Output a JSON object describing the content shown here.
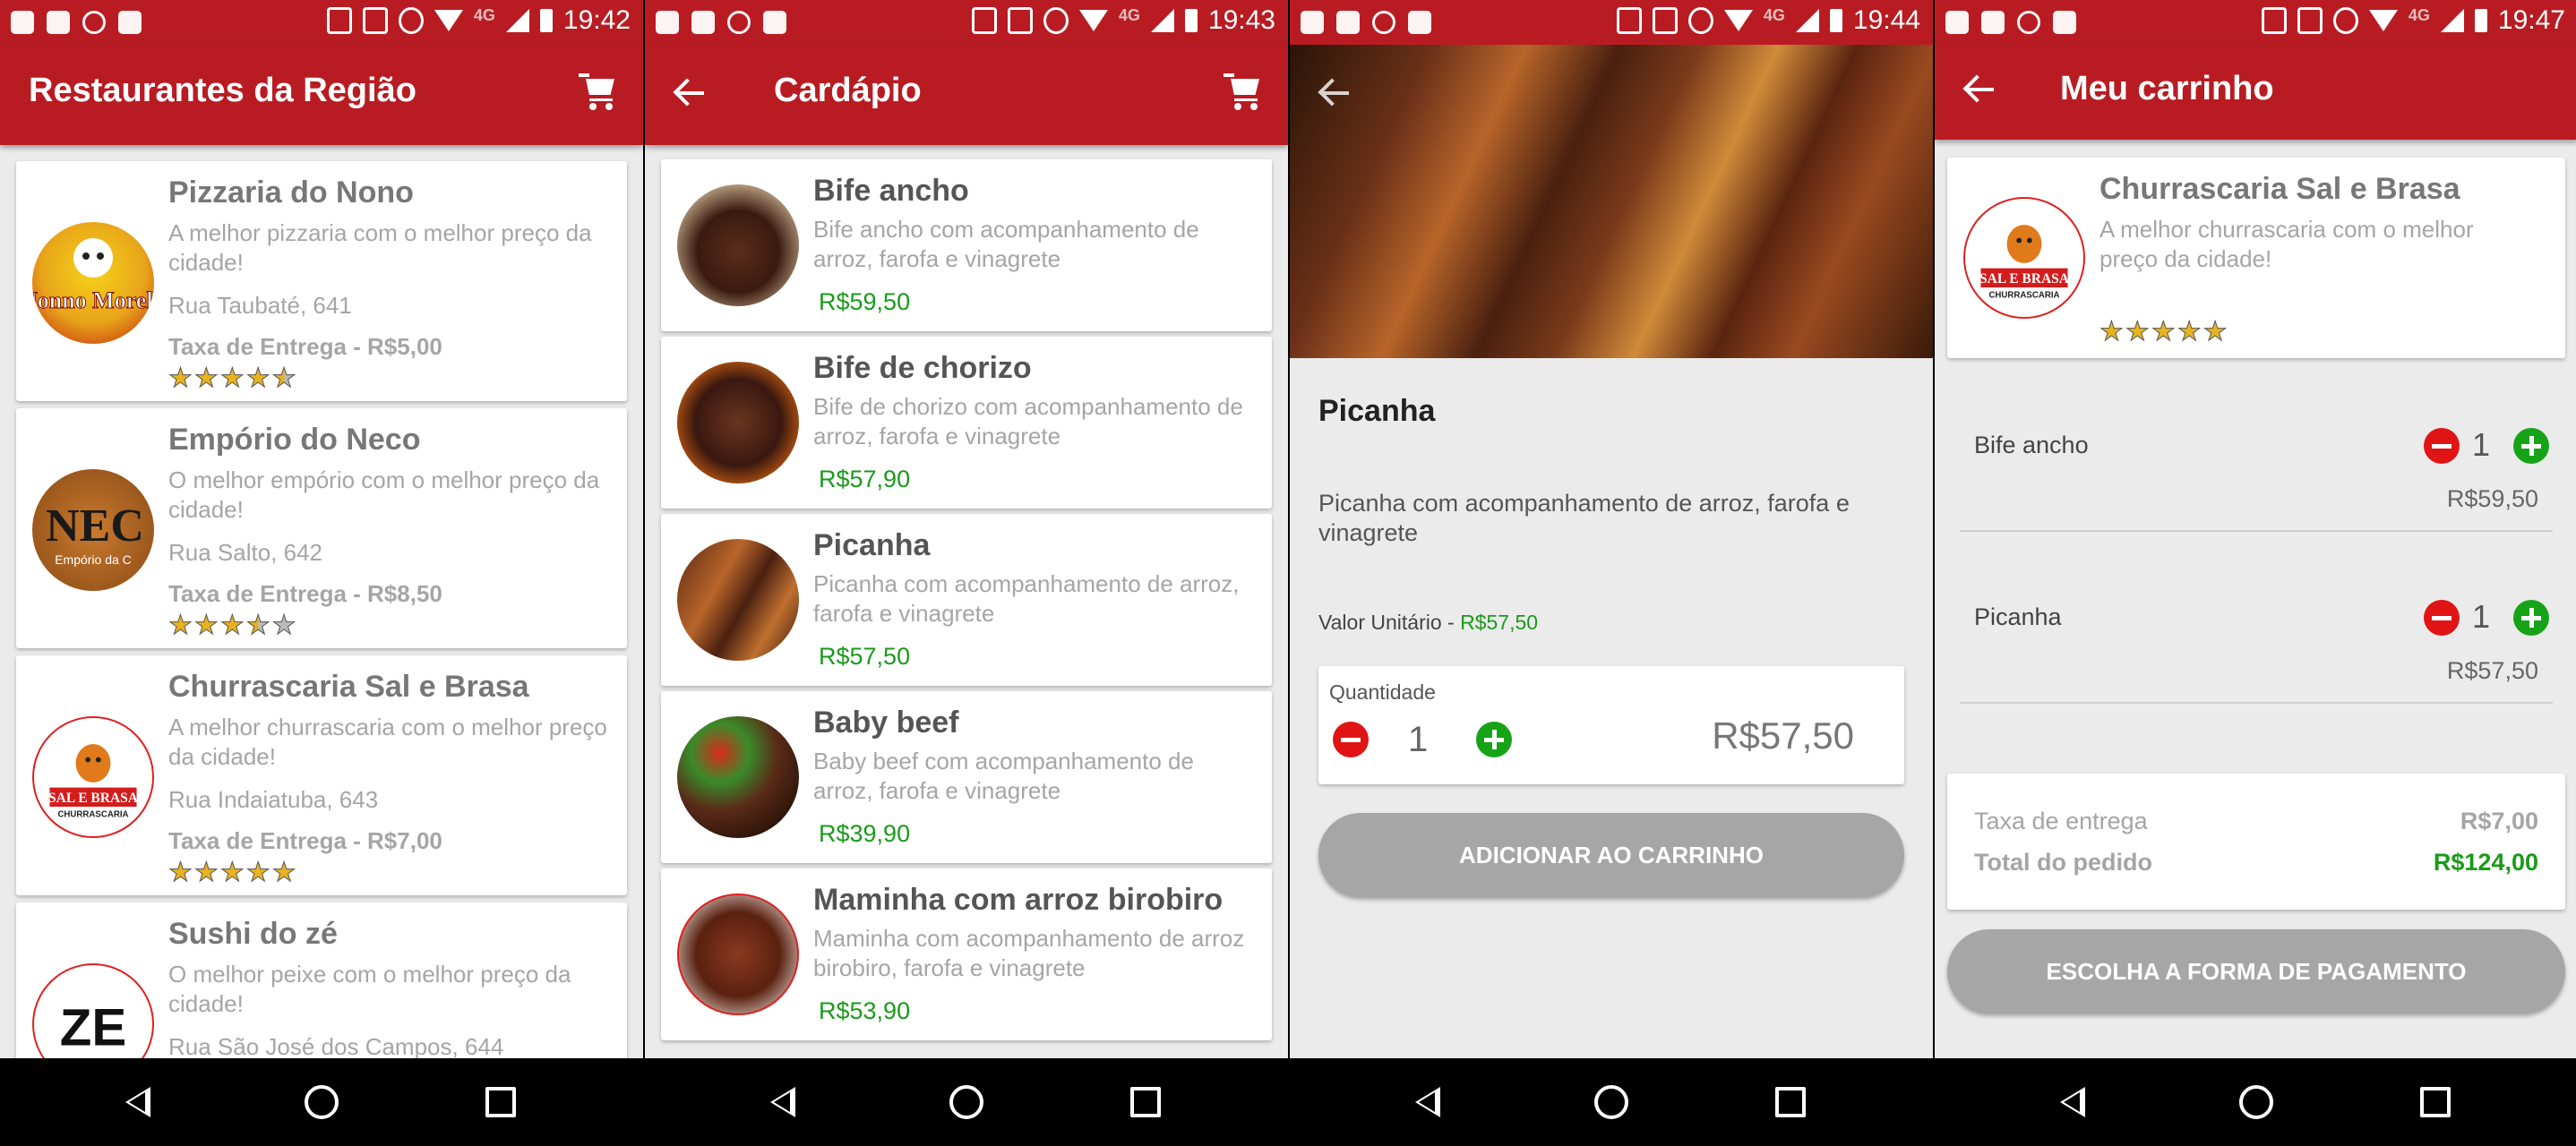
{
  "colors": {
    "brand": "#b81c22",
    "price_green": "#1a9b1a",
    "button_gray": "#a6a6a6"
  },
  "status_times": [
    "19:42",
    "19:43",
    "19:44",
    "19:47"
  ],
  "status_network": "4G",
  "screen1": {
    "title": "Restaurantes da Região",
    "restaurants": [
      {
        "name": "Pizzaria do Nono",
        "description": "A melhor pizzaria com o melhor preço da cidade!",
        "address": "Rua Taubaté, 641",
        "fee": "Taxa de Entrega - R$5,00",
        "rating": 4.5,
        "logo_text": "Nonno Morelli"
      },
      {
        "name": "Empório do Neco",
        "description": "O melhor empório com o melhor preço da cidade!",
        "address": "Rua Salto, 642",
        "fee": "Taxa de Entrega - R$8,50",
        "rating": 3.5,
        "logo_text": "NEC",
        "logo_sub": "Empório da C"
      },
      {
        "name": "Churrascaria Sal e Brasa",
        "description": "A melhor churrascaria com o melhor preço da cidade!",
        "address": "Rua Indaiatuba, 643",
        "fee": "Taxa de Entrega - R$7,00",
        "rating": 5,
        "logo_text": "SAL E BRASA",
        "logo_sub": "CHURRASCARIA"
      },
      {
        "name": "Sushi do zé",
        "description": "O melhor peixe com o melhor preço da cidade!",
        "address": "Rua São José dos Campos, 644",
        "logo_text": "ZE"
      }
    ]
  },
  "screen2": {
    "title": "Cardápio",
    "items": [
      {
        "name": "Bife ancho",
        "description": "Bife ancho com acompanhamento de arroz, farofa e vinagrete",
        "price": "R$59,50"
      },
      {
        "name": "Bife de chorizo",
        "description": "Bife de chorizo com acompanhamento de arroz, farofa e vinagrete",
        "price": "R$57,90"
      },
      {
        "name": "Picanha",
        "description": "Picanha com acompanhamento de arroz, farofa e vinagrete",
        "price": "R$57,50"
      },
      {
        "name": "Baby beef",
        "description": "Baby beef com acompanhamento de arroz, farofa e vinagrete",
        "price": "R$39,90"
      },
      {
        "name": "Maminha com arroz birobiro",
        "description": "Maminha com acompanhamento de arroz birobiro, farofa e vinagrete",
        "price": "R$53,90"
      }
    ]
  },
  "screen3": {
    "name": "Picanha",
    "description": "Picanha com acompanhamento de arroz, farofa e vinagrete",
    "unit_label": "Valor Unitário - ",
    "unit_price": "R$57,50",
    "qty_label": "Quantidade",
    "qty": "1",
    "total": "R$57,50",
    "button": "ADICIONAR AO CARRINHO"
  },
  "screen4": {
    "title": "Meu carrinho",
    "restaurant": {
      "name": "Churrascaria Sal e Brasa",
      "description": "A melhor churrascaria com o melhor preço da cidade!",
      "rating": 5
    },
    "items": [
      {
        "name": "Bife ancho",
        "qty": "1",
        "price": "R$59,50"
      },
      {
        "name": "Picanha",
        "qty": "1",
        "price": "R$57,50"
      }
    ],
    "delivery_label": "Taxa de entrega",
    "delivery_value": "R$7,00",
    "total_label": "Total do pedido",
    "total_value": "R$124,00",
    "button": "ESCOLHA A FORMA DE PAGAMENTO"
  }
}
